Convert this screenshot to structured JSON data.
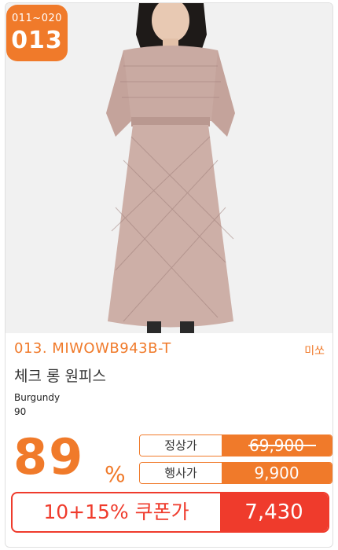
{
  "badge": {
    "range": "011~020",
    "number": "013"
  },
  "product": {
    "code": "013. MIWOWB943B-T",
    "brand": "미쏘",
    "name": "체크 롱 원피스",
    "color": "Burgundy",
    "size": "90"
  },
  "discount": {
    "percent": "89",
    "unit": "%"
  },
  "prices": {
    "regular_label": "정상가",
    "regular_value": "69,900",
    "event_label": "행사가",
    "event_value": "9,900",
    "coupon_label": "10+15% 쿠폰가",
    "coupon_value": "7,430"
  },
  "colors": {
    "accent": "#f07a2a",
    "coupon": "#ef3b2c",
    "dress": "#c9aaa2"
  }
}
